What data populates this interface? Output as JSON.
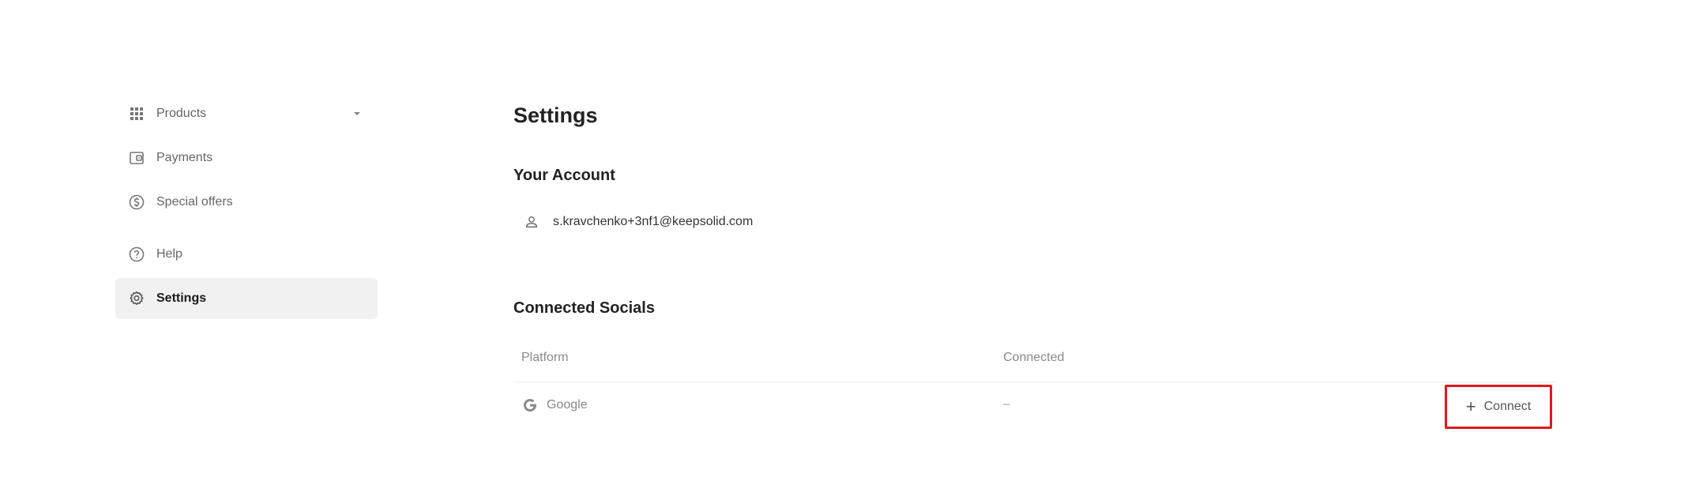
{
  "sidebar": {
    "items": [
      {
        "label": "Products",
        "icon": "grid-icon",
        "has_dropdown": true
      },
      {
        "label": "Payments",
        "icon": "wallet-icon"
      },
      {
        "label": "Special offers",
        "icon": "dollar-circle-icon"
      },
      {
        "label": "Help",
        "icon": "help-circle-icon"
      },
      {
        "label": "Settings",
        "icon": "gear-icon",
        "active": true
      }
    ]
  },
  "main": {
    "title": "Settings",
    "account": {
      "section_title": "Your Account",
      "email": "s.kravchenko+3nf1@keepsolid.com",
      "icon": "user-icon"
    },
    "socials": {
      "section_title": "Connected Socials",
      "columns": [
        "Platform",
        "Connected"
      ],
      "rows": [
        {
          "platform": "Google",
          "icon": "google-icon",
          "connected": "–",
          "action_label": "Connect"
        }
      ]
    }
  },
  "colors": {
    "active_bg": "#f1f1f1",
    "highlight_border": "#e0181b",
    "muted_text": "#8a8a8a"
  }
}
